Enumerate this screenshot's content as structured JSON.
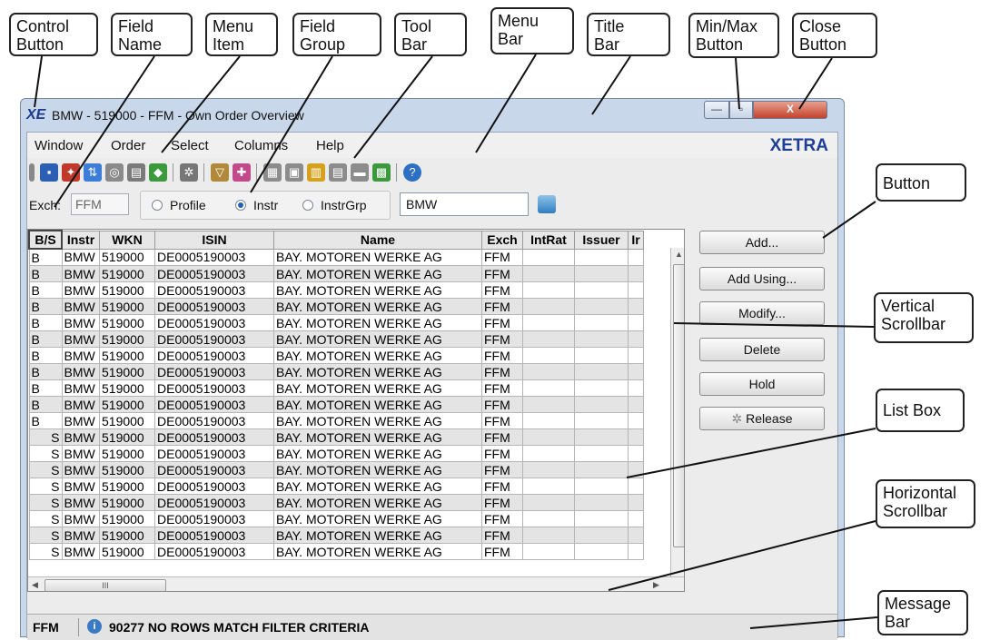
{
  "callouts": {
    "control_button": "Control\nButton",
    "field_name": "Field\nName",
    "menu_item": "Menu\nItem",
    "field_group": "Field\nGroup",
    "tool_bar": "Tool\nBar",
    "menu_bar": "Menu\nBar",
    "title_bar": "Title\nBar",
    "minmax_button": "Min/Max\nButton",
    "close_button": "Close\nButton",
    "button": "Button",
    "vertical_scrollbar": "Vertical\nScrollbar",
    "list_box": "List Box",
    "horizontal_scrollbar": "Horizontal\nScrollbar",
    "message_bar": "Message\nBar"
  },
  "window": {
    "logo": "XE",
    "title": "BMW - 519000 - FFM - Own Order Overview",
    "min_glyph": "—",
    "max_glyph": "▫",
    "close_glyph": "X"
  },
  "menu": {
    "items": [
      "Window",
      "Order",
      "Select",
      "Columns",
      "Help"
    ],
    "brand": "XETRA"
  },
  "toolbar_icons": [
    "save-icon",
    "export-icon",
    "sort-icon",
    "view-icon",
    "print-icon",
    "upload-icon",
    "settings-icon",
    "filter-icon",
    "refresh-icon",
    "grid-icon",
    "copy-icon",
    "columns-icon",
    "table-icon",
    "panel-icon",
    "chart-icon",
    "help-icon"
  ],
  "filter": {
    "exch_label": "Exch:",
    "exch_value": "FFM",
    "radio_profile": "Profile",
    "radio_instr": "Instr",
    "radio_instrgrp": "InstrGrp",
    "selected": "Instr",
    "instrument_value": "BMW"
  },
  "table": {
    "columns": [
      "B/S",
      "Instr",
      "WKN",
      "ISIN",
      "Name",
      "Exch",
      "IntRat",
      "Issuer",
      "Ir"
    ],
    "rows": [
      [
        "B",
        "BMW",
        "519000",
        "DE0005190003",
        "BAY. MOTOREN WERKE AG",
        "FFM",
        "",
        "",
        ""
      ],
      [
        "B",
        "BMW",
        "519000",
        "DE0005190003",
        "BAY. MOTOREN WERKE AG",
        "FFM",
        "",
        "",
        ""
      ],
      [
        "B",
        "BMW",
        "519000",
        "DE0005190003",
        "BAY. MOTOREN WERKE AG",
        "FFM",
        "",
        "",
        ""
      ],
      [
        "B",
        "BMW",
        "519000",
        "DE0005190003",
        "BAY. MOTOREN WERKE AG",
        "FFM",
        "",
        "",
        ""
      ],
      [
        "B",
        "BMW",
        "519000",
        "DE0005190003",
        "BAY. MOTOREN WERKE AG",
        "FFM",
        "",
        "",
        ""
      ],
      [
        "B",
        "BMW",
        "519000",
        "DE0005190003",
        "BAY. MOTOREN WERKE AG",
        "FFM",
        "",
        "",
        ""
      ],
      [
        "B",
        "BMW",
        "519000",
        "DE0005190003",
        "BAY. MOTOREN WERKE AG",
        "FFM",
        "",
        "",
        ""
      ],
      [
        "B",
        "BMW",
        "519000",
        "DE0005190003",
        "BAY. MOTOREN WERKE AG",
        "FFM",
        "",
        "",
        ""
      ],
      [
        "B",
        "BMW",
        "519000",
        "DE0005190003",
        "BAY. MOTOREN WERKE AG",
        "FFM",
        "",
        "",
        ""
      ],
      [
        "B",
        "BMW",
        "519000",
        "DE0005190003",
        "BAY. MOTOREN WERKE AG",
        "FFM",
        "",
        "",
        ""
      ],
      [
        "B",
        "BMW",
        "519000",
        "DE0005190003",
        "BAY. MOTOREN WERKE AG",
        "FFM",
        "",
        "",
        ""
      ],
      [
        "S",
        "BMW",
        "519000",
        "DE0005190003",
        "BAY. MOTOREN WERKE AG",
        "FFM",
        "",
        "",
        ""
      ],
      [
        "S",
        "BMW",
        "519000",
        "DE0005190003",
        "BAY. MOTOREN WERKE AG",
        "FFM",
        "",
        "",
        ""
      ],
      [
        "S",
        "BMW",
        "519000",
        "DE0005190003",
        "BAY. MOTOREN WERKE AG",
        "FFM",
        "",
        "",
        ""
      ],
      [
        "S",
        "BMW",
        "519000",
        "DE0005190003",
        "BAY. MOTOREN WERKE AG",
        "FFM",
        "",
        "",
        ""
      ],
      [
        "S",
        "BMW",
        "519000",
        "DE0005190003",
        "BAY. MOTOREN WERKE AG",
        "FFM",
        "",
        "",
        ""
      ],
      [
        "S",
        "BMW",
        "519000",
        "DE0005190003",
        "BAY. MOTOREN WERKE AG",
        "FFM",
        "",
        "",
        ""
      ],
      [
        "S",
        "BMW",
        "519000",
        "DE0005190003",
        "BAY. MOTOREN WERKE AG",
        "FFM",
        "",
        "",
        ""
      ],
      [
        "S",
        "BMW",
        "519000",
        "DE0005190003",
        "BAY. MOTOREN WERKE AG",
        "FFM",
        "",
        "",
        ""
      ]
    ]
  },
  "buttons": {
    "add": "Add...",
    "add_using": "Add Using...",
    "modify": "Modify...",
    "delete": "Delete",
    "hold": "Hold",
    "release": "Release"
  },
  "statusbar": {
    "exchange": "FFM",
    "message": "90277 NO ROWS MATCH FILTER CRITERIA"
  },
  "colors": {
    "brand": "#1d3f99",
    "close": "#c4422b",
    "row_alt": "#e4e4e4"
  }
}
